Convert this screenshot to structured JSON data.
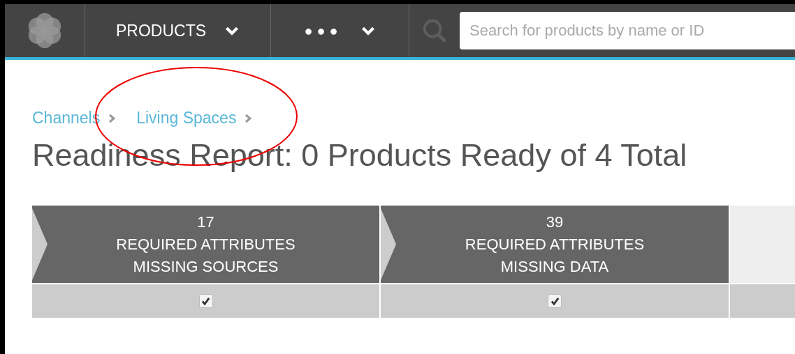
{
  "nav": {
    "menus": [
      {
        "label": "PRODUCTS",
        "kind": "text"
      },
      {
        "label": "●●●",
        "kind": "dots"
      }
    ],
    "search": {
      "placeholder": "Search for products by name or ID"
    }
  },
  "breadcrumb": [
    "Channels",
    "Living Spaces"
  ],
  "title": "Readiness Report: 0 Products Ready of 4 Total",
  "stages": [
    {
      "count": "17",
      "lines": [
        "REQUIRED ATTRIBUTES",
        "MISSING SOURCES"
      ],
      "checked": true
    },
    {
      "count": "39",
      "lines": [
        "REQUIRED ATTRIBUTES",
        "MISSING DATA"
      ],
      "checked": true
    }
  ]
}
